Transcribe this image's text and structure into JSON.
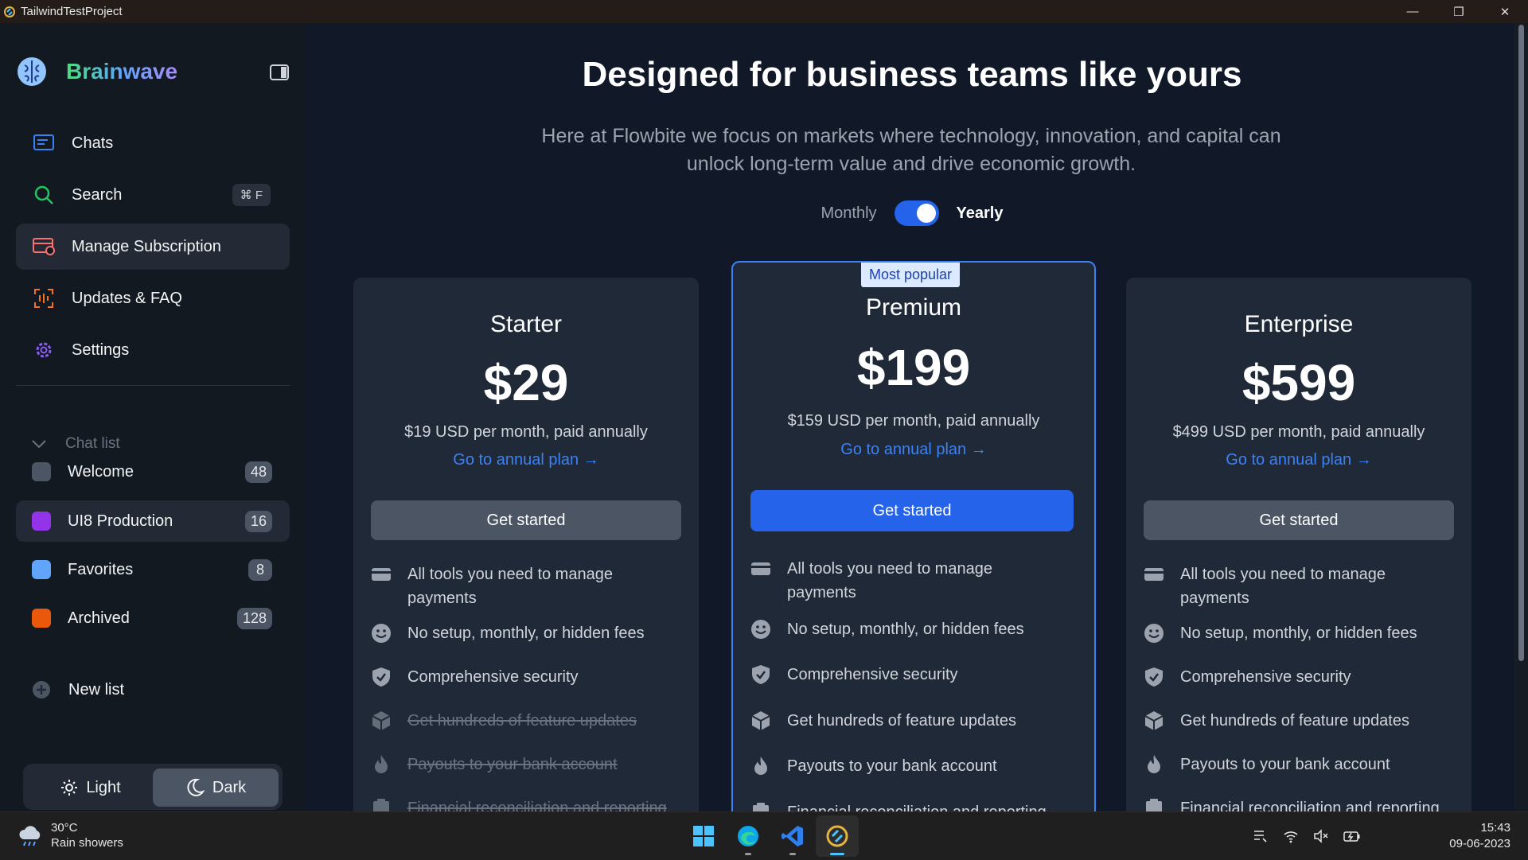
{
  "window": {
    "title": "TailwindTestProject"
  },
  "sidebar": {
    "brand": "Brainwave",
    "nav": [
      {
        "label": "Chats",
        "icon": "chat-icon"
      },
      {
        "label": "Search",
        "icon": "search-icon",
        "shortcut": "⌘ F"
      },
      {
        "label": "Manage Subscription",
        "icon": "card-icon",
        "active": true
      },
      {
        "label": "Updates & FAQ",
        "icon": "updates-icon"
      },
      {
        "label": "Settings",
        "icon": "gear-icon"
      }
    ],
    "chat_list_label": "Chat list",
    "lists": [
      {
        "label": "Welcome",
        "count": "48",
        "color": "#4b5563"
      },
      {
        "label": "UI8 Production",
        "count": "16",
        "color": "#9333ea"
      },
      {
        "label": "Favorites",
        "count": "8",
        "color": "#60a5fa"
      },
      {
        "label": "Archived",
        "count": "128",
        "color": "#ea580c"
      }
    ],
    "new_list": "New list",
    "theme": {
      "light": "Light",
      "dark": "Dark",
      "selected": "dark"
    }
  },
  "pricing": {
    "title": "Designed for business teams like yours",
    "subtitle": "Here at Flowbite we focus on markets where technology, innovation, and capital can unlock long-term value and drive economic growth.",
    "billing": {
      "monthly": "Monthly",
      "yearly": "Yearly",
      "yearly_selected": true
    },
    "plans": [
      {
        "name": "Starter",
        "price": "$29",
        "annual": "$19 USD per month, paid annually",
        "link": "Go to annual plan →",
        "cta": "Get started",
        "features": [
          {
            "text": "All tools you need to manage payments",
            "on": true
          },
          {
            "text": "No setup, monthly, or hidden fees",
            "on": true
          },
          {
            "text": "Comprehensive security",
            "on": true
          },
          {
            "text": "Get hundreds of feature updates",
            "on": false
          },
          {
            "text": "Payouts to your bank account",
            "on": false
          },
          {
            "text": "Financial reconciliation and reporting",
            "on": false
          }
        ]
      },
      {
        "name": "Premium",
        "badge": "Most popular",
        "price": "$199",
        "annual": "$159 USD per month, paid annually",
        "link": "Go to annual plan →",
        "cta": "Get started",
        "features": [
          {
            "text": "All tools you need to manage payments",
            "on": true
          },
          {
            "text": "No setup, monthly, or hidden fees",
            "on": true
          },
          {
            "text": "Comprehensive security",
            "on": true
          },
          {
            "text": "Get hundreds of feature updates",
            "on": true
          },
          {
            "text": "Payouts to your bank account",
            "on": true
          },
          {
            "text": "Financial reconciliation and reporting",
            "on": true
          }
        ]
      },
      {
        "name": "Enterprise",
        "price": "$599",
        "annual": "$499 USD per month, paid annually",
        "link": "Go to annual plan →",
        "cta": "Get started",
        "features": [
          {
            "text": "All tools you need to manage payments",
            "on": true
          },
          {
            "text": "No setup, monthly, or hidden fees",
            "on": true
          },
          {
            "text": "Comprehensive security",
            "on": true
          },
          {
            "text": "Get hundreds of feature updates",
            "on": true
          },
          {
            "text": "Payouts to your bank account",
            "on": true
          },
          {
            "text": "Financial reconciliation and reporting",
            "on": true
          }
        ]
      }
    ]
  },
  "taskbar": {
    "weather_temp": "30°C",
    "weather_desc": "Rain showers",
    "time": "15:43",
    "date": "09-06-2023",
    "apps": [
      "windows-start-icon",
      "edge-icon",
      "vscode-icon",
      "app-icon"
    ]
  }
}
